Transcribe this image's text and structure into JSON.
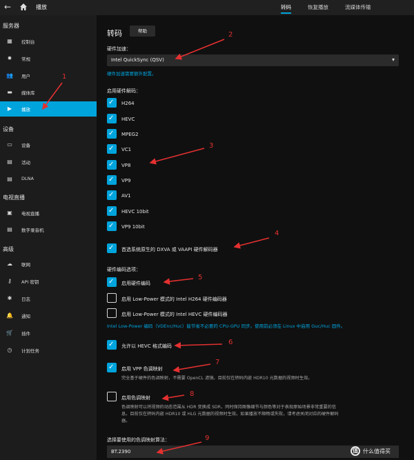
{
  "topbar": {
    "back_icon": "←",
    "title": "播放",
    "tabs": [
      "转码",
      "恢复播放",
      "流媒体传输"
    ],
    "active_tab": 0
  },
  "sidebar": {
    "sections": [
      {
        "title": "服务器",
        "items": [
          {
            "label": "控制台",
            "icon": "dashboard-icon",
            "glyph": "▦"
          },
          {
            "label": "常规",
            "icon": "gear-icon",
            "glyph": "✹"
          },
          {
            "label": "用户",
            "icon": "users-icon",
            "glyph": "👥"
          },
          {
            "label": "媒体库",
            "icon": "folder-icon",
            "glyph": "▬"
          },
          {
            "label": "播放",
            "icon": "play-icon",
            "glyph": "▶",
            "active": true
          }
        ]
      },
      {
        "title": "设备",
        "items": [
          {
            "label": "设备",
            "icon": "devices-icon",
            "glyph": "▭"
          },
          {
            "label": "活动",
            "icon": "activity-icon",
            "glyph": "▤"
          },
          {
            "label": "DLNA",
            "icon": "dlna-icon",
            "glyph": "▤"
          }
        ]
      },
      {
        "title": "电视直播",
        "items": [
          {
            "label": "电视直播",
            "icon": "tv-icon",
            "glyph": "▣"
          },
          {
            "label": "数字录音机",
            "icon": "dvr-icon",
            "glyph": "▤"
          }
        ]
      },
      {
        "title": "高级",
        "items": [
          {
            "label": "联网",
            "icon": "cloud-icon",
            "glyph": "☁"
          },
          {
            "label": "API 密钥",
            "icon": "key-icon",
            "glyph": "⚷"
          },
          {
            "label": "日志",
            "icon": "bug-icon",
            "glyph": "✱"
          },
          {
            "label": "通知",
            "icon": "bell-icon",
            "glyph": "🔔"
          },
          {
            "label": "插件",
            "icon": "cart-icon",
            "glyph": "🛒"
          },
          {
            "label": "计划任务",
            "icon": "clock-icon",
            "glyph": "◷"
          }
        ]
      }
    ]
  },
  "main": {
    "title": "转码",
    "help_button": "帮助",
    "hw_accel_label": "硬件加速：",
    "hw_accel_value": "Intel QuickSync (QSV)",
    "hw_accel_note": "硬件加速需要额外配置。",
    "enable_decode_label": "启用硬件解码：",
    "codecs": [
      {
        "label": "H264",
        "checked": true
      },
      {
        "label": "HEVC",
        "checked": true
      },
      {
        "label": "MPEG2",
        "checked": true
      },
      {
        "label": "VC1",
        "checked": true
      },
      {
        "label": "VP8",
        "checked": true
      },
      {
        "label": "VP9",
        "checked": true
      },
      {
        "label": "AV1",
        "checked": true
      },
      {
        "label": "HEVC 10bit",
        "checked": true
      },
      {
        "label": "VP9 10bit",
        "checked": true
      }
    ],
    "prefer_dxva": {
      "label": "首选系统原生的 DXVA 或 VAAPI 硬件解码器",
      "checked": true
    },
    "encode_options_label": "硬件编码选项：",
    "encode_options": [
      {
        "label": "启用硬件编码",
        "checked": true
      },
      {
        "label": "启用 Low-Power 模式的 Intel H264 硬件编码器",
        "checked": false
      },
      {
        "label": "启用 Low-Power 模式的 Intel HEVC 硬件编码器",
        "checked": false
      }
    ],
    "lowpower_note": "Intel Low-Power 编码（VDEnc/Huc）能节省不必要的 CPU-GPU 同步。使用前必须在 Linux 中启用 Guc/Huc 固件。",
    "allow_hevc": {
      "label": "允许以 HEVC 格式编码",
      "checked": true
    },
    "vpp_tonemap": {
      "label": "启用 VPP 色调映射",
      "checked": true
    },
    "vpp_desc": "完全基于硬件的色调映射，不需要 OpenCL 滤镜。目前仅在转码内嵌 HDR10 元数据的视频时生效。",
    "tonemap": {
      "label": "启用色调映射",
      "checked": false
    },
    "tonemap_desc_1": "色调映射可以将视频的动态范围从 HDR 变换成 SDR，同时保持图像细节与颜色等对于表现原始场景非常重要的信",
    "tonemap_desc_2": "息。目前仅在转码内嵌 HDR10 或 HLG 元数据的视频时生效。如果播放不顺畅或失败，请考虑关闭对应的硬件解码",
    "tonemap_desc_3": "器。",
    "algo_label": "选择要使用的色调映射算法：",
    "algo_value": "BT.2390"
  },
  "annotations": [
    "1",
    "2",
    "3",
    "4",
    "5",
    "6",
    "7",
    "8",
    "9"
  ],
  "watermark": {
    "text": "什么值得买",
    "icon_glyph": "值"
  },
  "colors": {
    "accent": "#00a4dc",
    "annotation": "#e53030",
    "background": "#101010",
    "sidebar": "#1c1c1c"
  }
}
